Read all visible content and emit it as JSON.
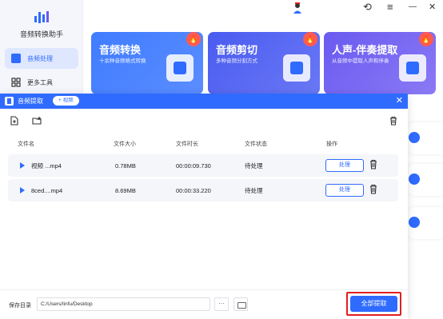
{
  "app": {
    "name": "音频转换助手",
    "nav": [
      {
        "label": "音频处理",
        "active": true
      },
      {
        "label": "更多工具",
        "active": false
      }
    ],
    "window_controls": {
      "refresh": "⟲",
      "menu": "≡",
      "minimize": "—",
      "close": "✕"
    }
  },
  "cards": [
    {
      "title": "音频转换",
      "subtitle": "十余种音频格式转换",
      "hot": "🔥",
      "color": "#3f7cff"
    },
    {
      "title": "音频剪切",
      "subtitle": "多种音频分割方式",
      "hot": "🔥",
      "color": "#4a5cf0"
    },
    {
      "title": "人声-伴奏提取",
      "subtitle": "从音频中提取人声和伴奏",
      "hot": "🔥",
      "color": "#6a5af0"
    }
  ],
  "modal": {
    "title": "音频提取",
    "add_badge": "+ 视频",
    "close": "✕",
    "columns": {
      "name": "文件名",
      "size": "文件大小",
      "duration": "文件时长",
      "status": "文件状态",
      "action": "操作"
    },
    "rows": [
      {
        "name": "视频 ...mp4",
        "size": "0.78MB",
        "duration": "00:00:09.730",
        "status": "待处理",
        "button": "处理"
      },
      {
        "name": "8ced....mp4",
        "size": "8.69MB",
        "duration": "00:00:33.220",
        "status": "待处理",
        "button": "处理"
      }
    ],
    "footer": {
      "label": "保存目录",
      "path": "C:/Users/linfu/Desktop",
      "more": "···",
      "extract_all": "全部提取"
    }
  },
  "colors": {
    "accent": "#2f6bff",
    "highlight_border": "#e02020",
    "row_bg": "#f5f6f9"
  }
}
